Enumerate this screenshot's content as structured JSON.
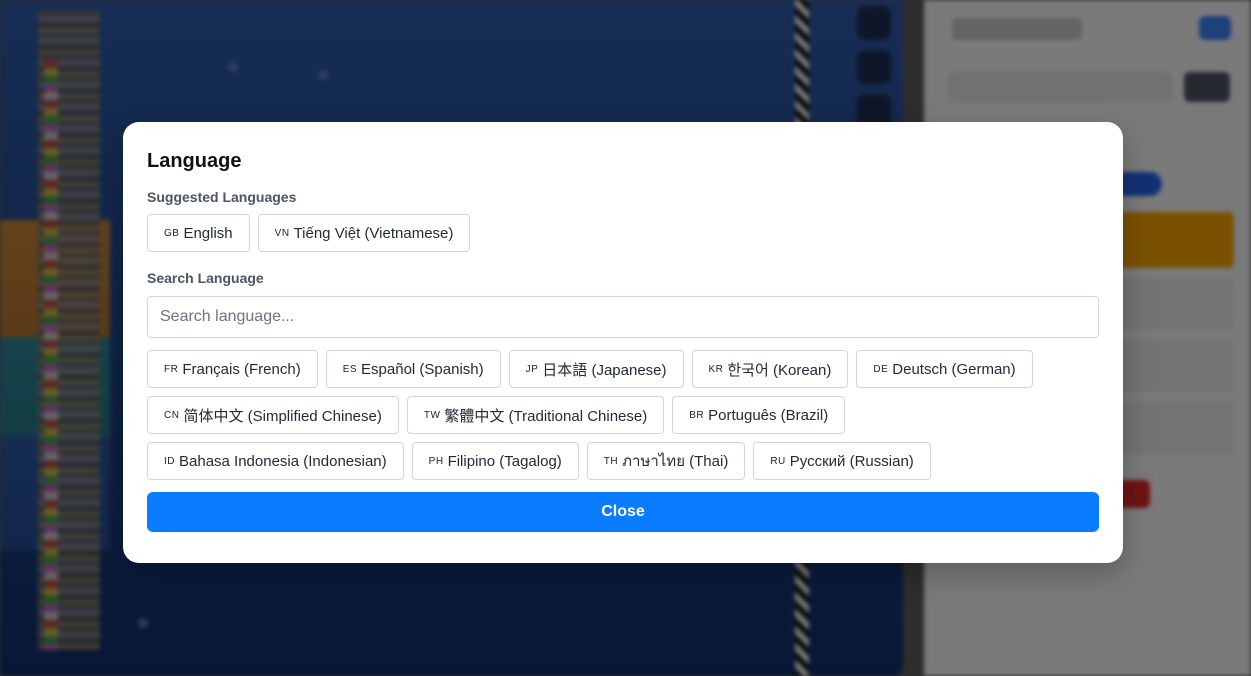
{
  "colors": {
    "accent": "#0a7cff",
    "overlay": "rgba(0,0,0,0.5)",
    "modal_bg": "#ffffff",
    "chip_border": "#d1d5db",
    "label_text": "#4b5563"
  },
  "modal": {
    "title": "Language",
    "suggested_label": "Suggested Languages",
    "suggested": [
      {
        "code": "GB",
        "label": "English"
      },
      {
        "code": "VN",
        "label": "Tiếng Việt (Vietnamese)"
      }
    ],
    "search_label": "Search Language",
    "search_placeholder": "Search language...",
    "search_value": "",
    "languages": [
      {
        "code": "FR",
        "label": "Français (French)"
      },
      {
        "code": "ES",
        "label": "Español (Spanish)"
      },
      {
        "code": "JP",
        "label": "日本語 (Japanese)"
      },
      {
        "code": "KR",
        "label": "한국어 (Korean)"
      },
      {
        "code": "DE",
        "label": "Deutsch (German)"
      },
      {
        "code": "CN",
        "label": "简体中文 (Simplified Chinese)"
      },
      {
        "code": "TW",
        "label": "繁體中文 (Traditional Chinese)"
      },
      {
        "code": "BR",
        "label": "Português (Brazil)"
      },
      {
        "code": "ID",
        "label": "Bahasa Indonesia (Indonesian)"
      },
      {
        "code": "PH",
        "label": "Filipino (Tagalog)"
      },
      {
        "code": "TH",
        "label": "ภาษาไทย (Thai)"
      },
      {
        "code": "RU",
        "label": "Русский (Russian)"
      }
    ],
    "close_label": "Close"
  }
}
